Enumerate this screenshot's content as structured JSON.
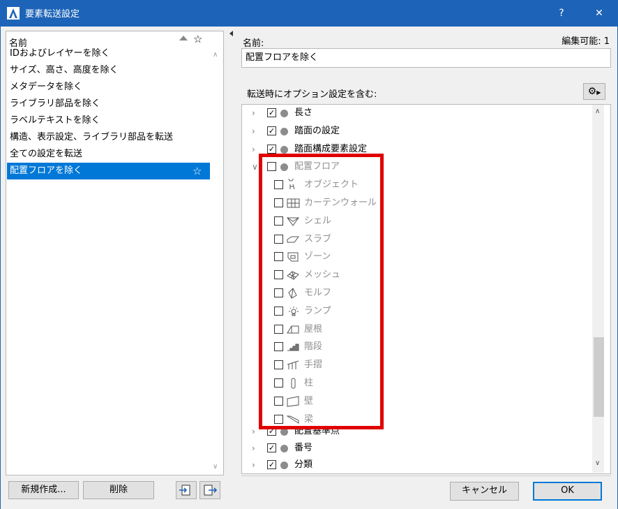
{
  "window": {
    "title": "要素転送設定",
    "help_label": "?",
    "close_label": "✕"
  },
  "list": {
    "header": "名前",
    "items": [
      {
        "label": "IDおよびレイヤーを除く",
        "selected": false
      },
      {
        "label": "サイズ、高さ、高度を除く",
        "selected": false
      },
      {
        "label": "メタデータを除く",
        "selected": false
      },
      {
        "label": "ライブラリ部品を除く",
        "selected": false
      },
      {
        "label": "ラベルテキストを除く",
        "selected": false
      },
      {
        "label": "構造、表示設定、ライブラリ部品を転送",
        "selected": false
      },
      {
        "label": "全ての設定を転送",
        "selected": false
      },
      {
        "label": "配置フロアを除く",
        "selected": true
      }
    ]
  },
  "buttons": {
    "new": "新規作成...",
    "delete": "削除",
    "cancel": "キャンセル",
    "ok": "OK"
  },
  "detail": {
    "name_label": "名前:",
    "editable_label": "編集可能: 1",
    "name_value": "配置フロアを除く",
    "options_label": "転送時にオプション設定を含む:"
  },
  "tree": {
    "top_rows": [
      {
        "label": "長さ",
        "checked": true
      },
      {
        "label": "踏面の設定",
        "checked": true
      },
      {
        "label": "踏面構成要素設定",
        "checked": true
      }
    ],
    "group": {
      "label": "配置フロア",
      "checked": false,
      "expanded": true
    },
    "children": [
      {
        "label": "オブジェクト",
        "icon": "object-icon",
        "checked": false
      },
      {
        "label": "カーテンウォール",
        "icon": "curtain-wall-icon",
        "checked": false
      },
      {
        "label": "シェル",
        "icon": "shell-icon",
        "checked": false
      },
      {
        "label": "スラブ",
        "icon": "slab-icon",
        "checked": false
      },
      {
        "label": "ゾーン",
        "icon": "zone-icon",
        "checked": false
      },
      {
        "label": "メッシュ",
        "icon": "mesh-icon",
        "checked": false
      },
      {
        "label": "モルフ",
        "icon": "morph-icon",
        "checked": false
      },
      {
        "label": "ランプ",
        "icon": "lamp-icon",
        "checked": false
      },
      {
        "label": "屋根",
        "icon": "roof-icon",
        "checked": false
      },
      {
        "label": "階段",
        "icon": "stair-icon",
        "checked": false
      },
      {
        "label": "手摺",
        "icon": "railing-icon",
        "checked": false
      },
      {
        "label": "柱",
        "icon": "column-icon",
        "checked": false
      },
      {
        "label": "壁",
        "icon": "wall-icon",
        "checked": false
      },
      {
        "label": "梁",
        "icon": "beam-icon",
        "checked": false
      }
    ],
    "bottom_rows": [
      {
        "label": "配置基準点",
        "checked": true
      },
      {
        "label": "番号",
        "checked": true
      },
      {
        "label": "分類",
        "checked": true
      }
    ]
  },
  "colors": {
    "titlebar": "#1d64b8",
    "selection": "#0078d7",
    "highlight_box": "#e00000"
  }
}
